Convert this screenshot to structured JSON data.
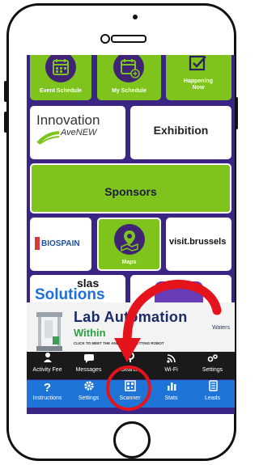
{
  "tiles": {
    "event_schedule": "Event Schedule",
    "my_schedule": "My Schedule",
    "happening_now": "Happening Now",
    "innovation_line1": "Innovation",
    "innovation_line2": "AveNEW",
    "exhibition": "Exhibition",
    "sponsors": "Sponsors",
    "biospain": "BIOSPAIN",
    "maps": "Maps",
    "visit_brussels": "visit.brussels",
    "slas": "slas",
    "solutions": "Solutions"
  },
  "ad": {
    "title": "Lab Automation",
    "subtitle": "Within",
    "small": "CLICK TO MEET THE ANDREW+ PIPETTING ROBOT",
    "brand": "Waters"
  },
  "nav_top": [
    {
      "label": "Activity Fee",
      "icon": "activity-icon"
    },
    {
      "label": "Messages",
      "icon": "messages-icon"
    },
    {
      "label": "Search",
      "icon": "search-icon"
    },
    {
      "label": "Wi-Fi",
      "icon": "wifi-icon"
    },
    {
      "label": "Settings",
      "icon": "settings-icon"
    }
  ],
  "nav_bottom": [
    {
      "label": "Instructions",
      "icon": "question-icon"
    },
    {
      "label": "Settings",
      "icon": "gear-icon"
    },
    {
      "label": "Scanner",
      "icon": "qr-icon"
    },
    {
      "label": "Stats",
      "icon": "bar-chart-icon"
    },
    {
      "label": "Leads",
      "icon": "leads-icon"
    }
  ],
  "colors": {
    "screen_bg": "#3a2584",
    "tile_green": "#7ec41c",
    "nav_dark": "#1a1a1a",
    "nav_blue": "#1f74d8",
    "annotation_red": "#e5141c"
  }
}
